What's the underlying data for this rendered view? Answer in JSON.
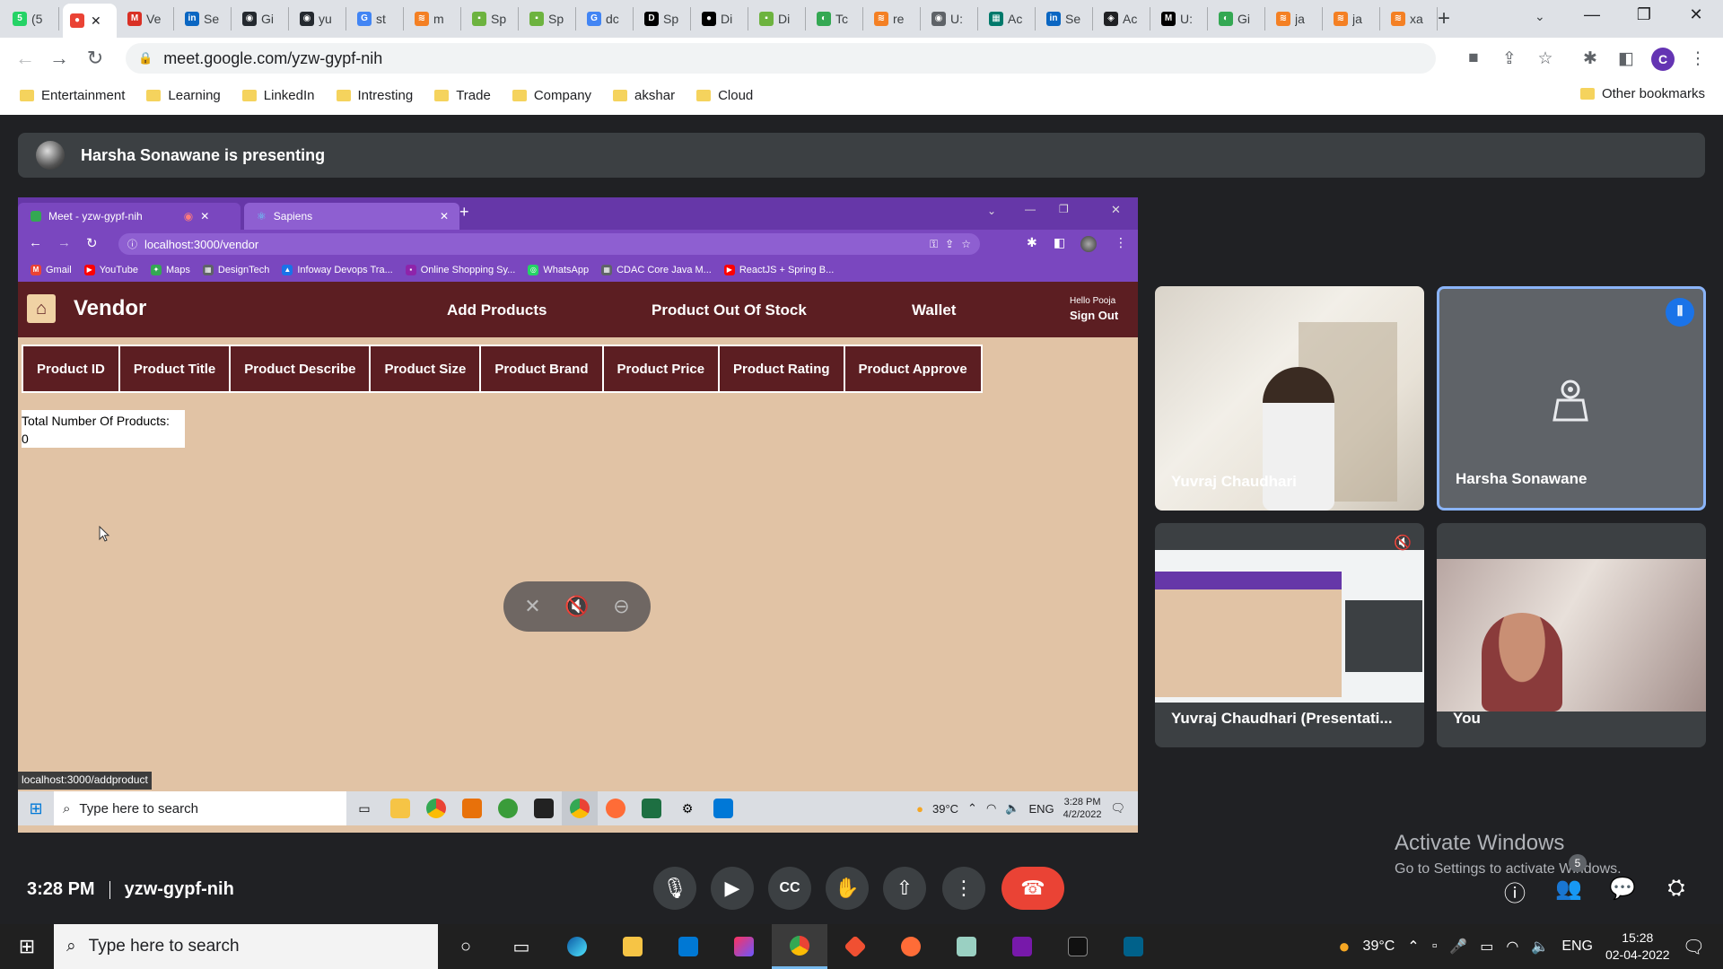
{
  "outer_tabs": [
    {
      "label": "(5",
      "color": "#25d366",
      "glyph": "5"
    },
    {
      "label": "",
      "color": "#ea4335",
      "glyph": "●",
      "active": true
    },
    {
      "label": "Ve",
      "color": "#d93025",
      "glyph": "M"
    },
    {
      "label": "Se",
      "color": "#0a66c2",
      "glyph": "in"
    },
    {
      "label": "Gi",
      "color": "#24292f",
      "glyph": "◉"
    },
    {
      "label": "yu",
      "color": "#24292f",
      "glyph": "◉"
    },
    {
      "label": "st",
      "color": "#4285f4",
      "glyph": "G"
    },
    {
      "label": "m",
      "color": "#f48024",
      "glyph": "≋"
    },
    {
      "label": "Sp",
      "color": "#6db33f",
      "glyph": "▪"
    },
    {
      "label": "Sp",
      "color": "#6db33f",
      "glyph": "▪"
    },
    {
      "label": "dc",
      "color": "#4285f4",
      "glyph": "G"
    },
    {
      "label": "Sp",
      "color": "#000000",
      "glyph": "D"
    },
    {
      "label": "Di",
      "color": "#000000",
      "glyph": "●"
    },
    {
      "label": "Di",
      "color": "#6db33f",
      "glyph": "▪"
    },
    {
      "label": "Tc",
      "color": "#34a853",
      "glyph": "◐"
    },
    {
      "label": "re",
      "color": "#f48024",
      "glyph": "≋"
    },
    {
      "label": "U:",
      "color": "#5f6368",
      "glyph": "◉"
    },
    {
      "label": "Ac",
      "color": "#00796b",
      "glyph": "▦"
    },
    {
      "label": "Se",
      "color": "#0a66c2",
      "glyph": "in"
    },
    {
      "label": "Ac",
      "color": "#202124",
      "glyph": "◈"
    },
    {
      "label": "U:",
      "color": "#000000",
      "glyph": "M"
    },
    {
      "label": "Gi",
      "color": "#34a853",
      "glyph": "◐"
    },
    {
      "label": "ja",
      "color": "#f48024",
      "glyph": "≋"
    },
    {
      "label": "ja",
      "color": "#f48024",
      "glyph": "≋"
    },
    {
      "label": "xa",
      "color": "#f48024",
      "glyph": "≋"
    }
  ],
  "address": {
    "url": "meet.google.com/yzw-gypf-nih"
  },
  "profile_initial": "C",
  "bookmarks": [
    "Entertainment",
    "Learning",
    "LinkedIn",
    "Intresting",
    "Trade",
    "Company",
    "akshar",
    "Cloud"
  ],
  "other_bookmarks": "Other bookmarks",
  "presenting": "Harsha Sonawane is presenting",
  "shared": {
    "tabs": [
      {
        "label": "Meet - yzw-gypf-nih"
      },
      {
        "label": "Sapiens"
      }
    ],
    "url": "localhost:3000/vendor",
    "bookmarks": [
      {
        "label": "Gmail",
        "color": "#ea4335",
        "glyph": "M"
      },
      {
        "label": "YouTube",
        "color": "#ff0000",
        "glyph": "▶"
      },
      {
        "label": "Maps",
        "color": "#34a853",
        "glyph": "✦"
      },
      {
        "label": "DesignTech",
        "color": "#5f6368",
        "glyph": "▦"
      },
      {
        "label": "Infoway Devops Tra...",
        "color": "#1a73e8",
        "glyph": "▲"
      },
      {
        "label": "Online Shopping Sy...",
        "color": "#8e24aa",
        "glyph": "▪"
      },
      {
        "label": "WhatsApp",
        "color": "#25d366",
        "glyph": "◎"
      },
      {
        "label": "CDAC Core Java M...",
        "color": "#5f6368",
        "glyph": "▦"
      },
      {
        "label": "ReactJS + Spring B...",
        "color": "#ff0000",
        "glyph": "▶"
      }
    ],
    "vendor": {
      "title": "Vendor",
      "nav": [
        "Add Products",
        "Product Out Of Stock",
        "Wallet"
      ],
      "hello": "Hello Pooja",
      "signout": "Sign Out"
    },
    "table_headers": [
      "Product ID",
      "Product Title",
      "Product Describe",
      "Product Size",
      "Product Brand",
      "Product Price",
      "Product Rating",
      "Product Approve"
    ],
    "total_label": "Total Number Of Products:",
    "total_value": "0",
    "status_url": "localhost:3000/addproduct",
    "taskbar": {
      "search": "Type here to search",
      "temp": "39°C",
      "lang": "ENG",
      "time": "3:28 PM",
      "date": "4/2/2022"
    }
  },
  "participants": [
    "Yuvraj Chaudhari",
    "Harsha Sonawane",
    "Yuvraj Chaudhari (Presentati...",
    "You"
  ],
  "activate": {
    "title": "Activate Windows",
    "subtitle": "Go to Settings to activate Windows."
  },
  "meeting": {
    "time": "3:28 PM",
    "code": "yzw-gypf-nih",
    "people_count": "5"
  },
  "taskbar": {
    "search": "Type here to search",
    "temp": "39°C",
    "lang": "ENG",
    "time": "15:28",
    "date": "02-04-2022"
  }
}
